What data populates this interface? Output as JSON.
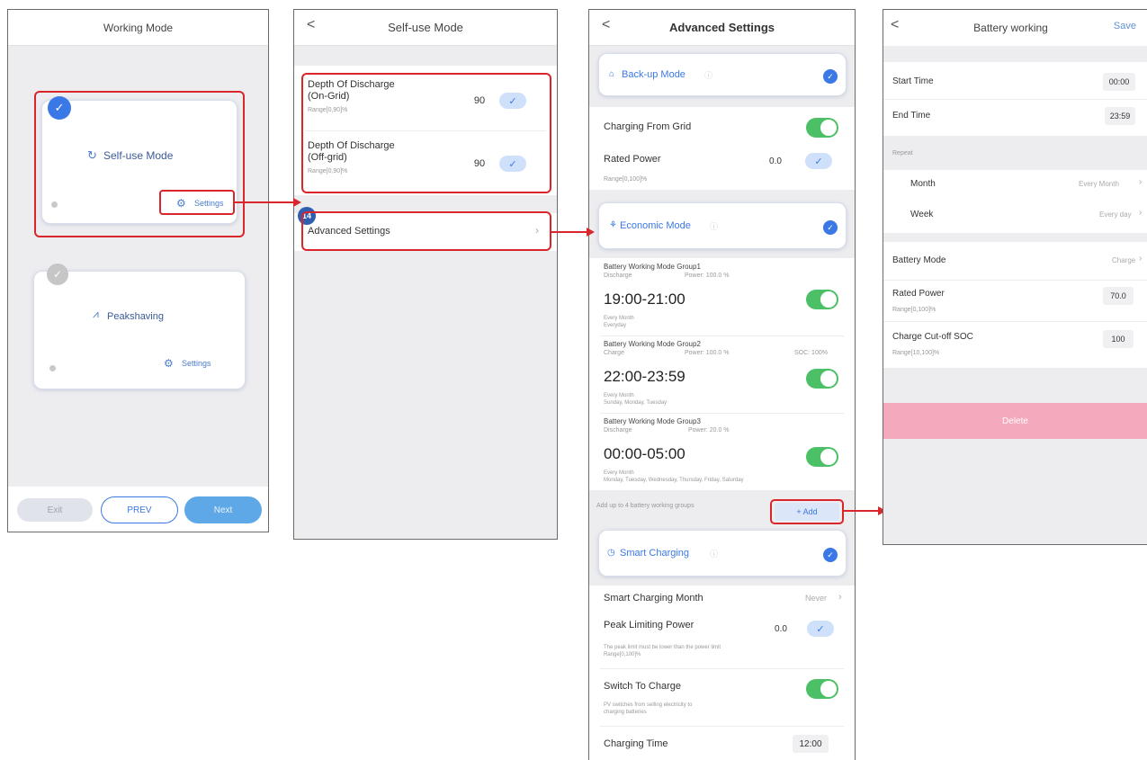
{
  "panel1": {
    "title": "Working Mode",
    "selfuse_label": "Self-use Mode",
    "settings_label": "Settings",
    "peak_label": "Peakshaving",
    "peak_settings_label": "Settings",
    "exit_label": "Exit",
    "prev_label": "PREV",
    "next_label": "Next"
  },
  "panel2": {
    "title": "Self-use Mode",
    "dod_on_label_1": "Depth Of Discharge",
    "dod_on_label_2": "(On-Grid)",
    "dod_on_range": "Range[0,90]%",
    "dod_on_value": "90",
    "dod_off_label_1": "Depth Of Discharge",
    "dod_off_label_2": "(Off-grid)",
    "dod_off_range": "Range[0,90]%",
    "dod_off_value": "90",
    "step_badge": "14",
    "advanced_label": "Advanced Settings"
  },
  "panel3": {
    "title": "Advanced Settings",
    "backup_label": "Back-up Mode",
    "charging_grid_label": "Charging From Grid",
    "rated_power_label": "Rated Power",
    "rated_power_value": "0.0",
    "rated_power_range": "Range[0,100]%",
    "economic_label": "Economic Mode",
    "groups": [
      {
        "name": "Battery Working Mode Group1",
        "mode": "Discharge",
        "power": "Power: 100.0 %",
        "soc": "",
        "time": "19:00-21:00",
        "repeat1": "Every Month",
        "repeat2": "Everyday"
      },
      {
        "name": "Battery Working Mode Group2",
        "mode": "Charge",
        "power": "Power: 100.0 %",
        "soc": "SOC: 100%",
        "time": "22:00-23:59",
        "repeat1": "Every Month",
        "repeat2": "Sunday, Monday, Tuesday"
      },
      {
        "name": "Battery Working Mode Group3",
        "mode": "Discharge",
        "power": "Power: 20.0 %",
        "soc": "",
        "time": "00:00-05:00",
        "repeat1": "Every Month",
        "repeat2": "Monday, Tuesday, Wednesday, Thursday, Friday, Saturday"
      }
    ],
    "add_hint": "Add up to 4 battery working groups",
    "add_label": "+ Add",
    "smart_label": "Smart Charging",
    "smart_month_label": "Smart Charging Month",
    "smart_month_value": "Never",
    "peak_power_label": "Peak Limiting Power",
    "peak_power_value": "0.0",
    "peak_hint_1": "The peak limit must be lower than the power limit",
    "peak_hint_2": "Range[0,100]%",
    "switch_label": "Switch To Charge",
    "switch_hint_1": "PV switches from selling electricity to",
    "switch_hint_2": "charging batteries",
    "charging_time_label": "Charging Time",
    "charging_time_value": "12:00"
  },
  "panel4": {
    "title": "Battery working",
    "save_label": "Save",
    "start_label": "Start Time",
    "start_value": "00:00",
    "end_label": "End Time",
    "end_value": "23:59",
    "repeat_label": "Repeat",
    "month_label": "Month",
    "month_value": "Every Month",
    "week_label": "Week",
    "week_value": "Every day",
    "battery_mode_label": "Battery Mode",
    "battery_mode_value": "Charge",
    "rated_label": "Rated Power",
    "rated_value": "70.0",
    "rated_range": "Range[0,100]%",
    "cutoff_label": "Charge Cut-off SOC",
    "cutoff_value": "100",
    "cutoff_range": "Range[10,100]%",
    "delete_label": "Delete"
  },
  "colors": {
    "accent": "#3b78e7",
    "highlight": "#d9262b",
    "toggle_on": "#4cc066",
    "delete_bg": "#f4a9bd",
    "next_btn": "#5fa8e8"
  }
}
